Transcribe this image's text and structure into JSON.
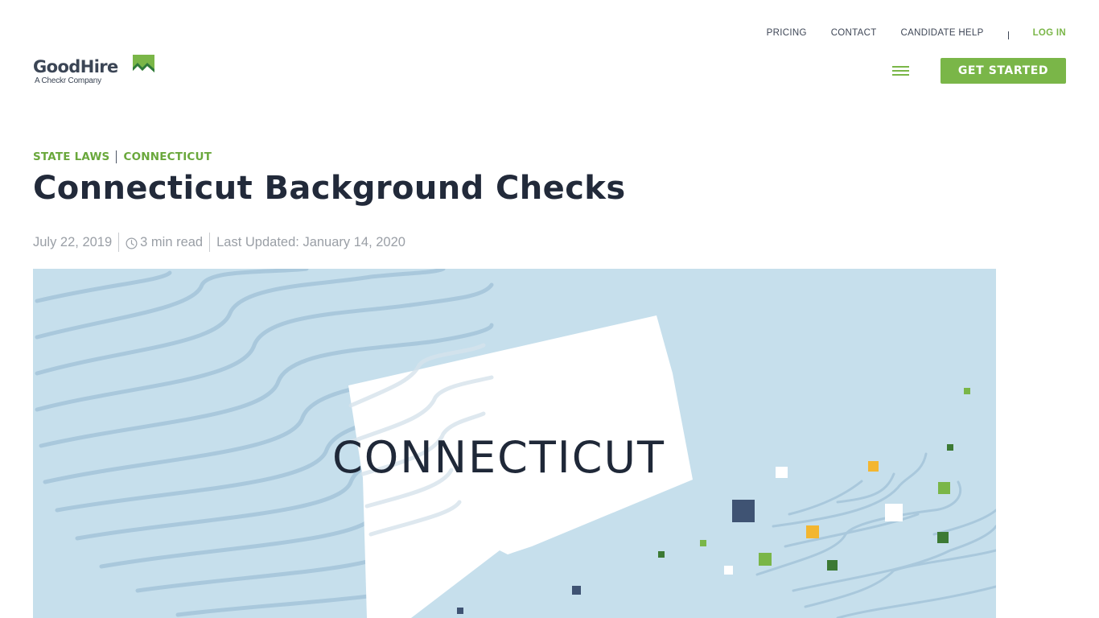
{
  "brand": {
    "name": "GoodHire",
    "tagline": "A Checkr Company",
    "accent_color": "#7ab648"
  },
  "topnav": {
    "items": [
      {
        "label": "PRICING"
      },
      {
        "label": "CONTACT"
      },
      {
        "label": "CANDIDATE HELP"
      }
    ],
    "login_label": "LOG IN"
  },
  "header": {
    "menu_icon": "hamburger-menu-icon",
    "cta_label": "GET STARTED"
  },
  "breadcrumb": [
    {
      "label": "STATE LAWS"
    },
    {
      "label": "CONNECTICUT"
    }
  ],
  "article": {
    "title": "Connecticut Background Checks",
    "date": "July 22, 2019",
    "read_time_icon": "clock-icon",
    "read_time": "3 min read",
    "last_updated": "Last Updated: January 14, 2020"
  },
  "hero": {
    "label": "CONNECTICUT",
    "background_color": "#c6dfec",
    "square_colors": {
      "navy": "#3f5373",
      "green": "#7ab648",
      "dark_green": "#3c7a34",
      "yellow": "#f3b630",
      "white": "#ffffff"
    }
  }
}
